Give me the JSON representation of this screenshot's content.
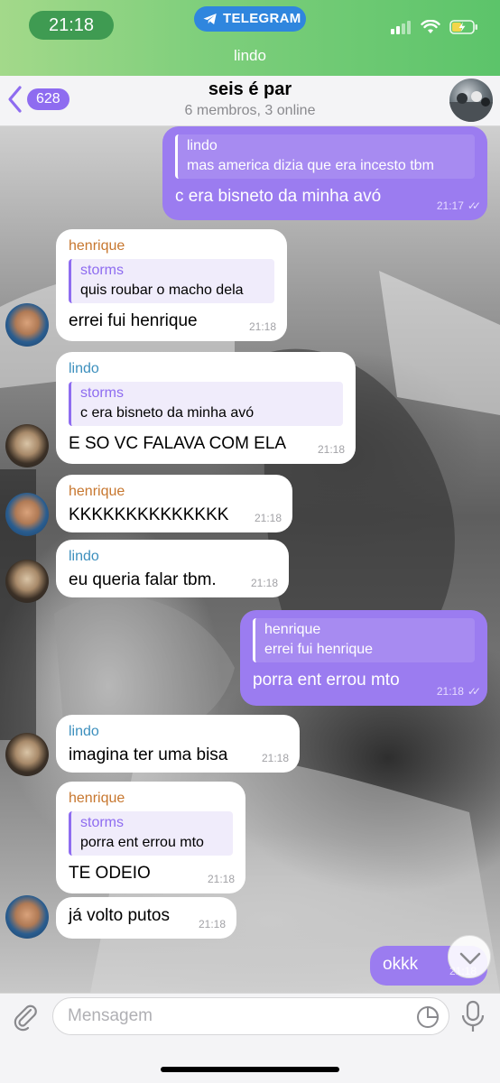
{
  "status_bar": {
    "time": "21:18",
    "app_pill": "TELEGRAM",
    "chat_subtitle": "lindo"
  },
  "header": {
    "back_badge": "628",
    "title": "seis é par",
    "members": "6 membros, 3 online"
  },
  "messages": [
    {
      "dir": "out",
      "reply": {
        "name": "lindo",
        "text": "mas america dizia que era incesto tbm"
      },
      "text": "c era bisneto da minha avó",
      "time": "21:17"
    },
    {
      "dir": "in",
      "sender": "henrique",
      "reply": {
        "name": "storms",
        "text": "quis roubar o macho dela"
      },
      "text": "errei fui henrique",
      "time": "21:18"
    },
    {
      "dir": "in",
      "sender": "lindo",
      "reply": {
        "name": "storms",
        "text": "c era bisneto da minha avó"
      },
      "text": "E SO VC FALAVA COM ELA",
      "time": "21:18"
    },
    {
      "dir": "in",
      "sender": "henrique",
      "text": "KKKKKKKKKKKKKK",
      "time": "21:18"
    },
    {
      "dir": "in",
      "sender": "lindo",
      "text": "eu queria falar tbm.",
      "time": "21:18"
    },
    {
      "dir": "out",
      "reply": {
        "name": "henrique",
        "text": "errei fui henrique"
      },
      "text": "porra ent errou mto",
      "time": "21:18"
    },
    {
      "dir": "in",
      "sender": "lindo",
      "text": "imagina ter uma bisa",
      "time": "21:18"
    },
    {
      "dir": "in",
      "sender": "henrique",
      "reply": {
        "name": "storms",
        "text": "porra ent errou mto"
      },
      "text": "TE ODEIO",
      "time": "21:18"
    },
    {
      "dir": "in",
      "text": "já volto putos",
      "time": "21:18"
    },
    {
      "dir": "out",
      "text": "okkk",
      "time": "21:18"
    }
  ],
  "input": {
    "placeholder": "Mensagem"
  },
  "colors": {
    "accent": "#8e6cf0",
    "outgoing_bubble": "#9b7cf0",
    "henrique_name": "#c7772f",
    "lindo_name": "#3c8fbd",
    "status_bar": "#5cc46a"
  },
  "icons": [
    "telegram-icon",
    "signal-icon",
    "wifi-icon",
    "battery-icon",
    "back-chevron-icon",
    "attach-icon",
    "sticker-icon",
    "mic-icon",
    "chevron-down-icon"
  ]
}
